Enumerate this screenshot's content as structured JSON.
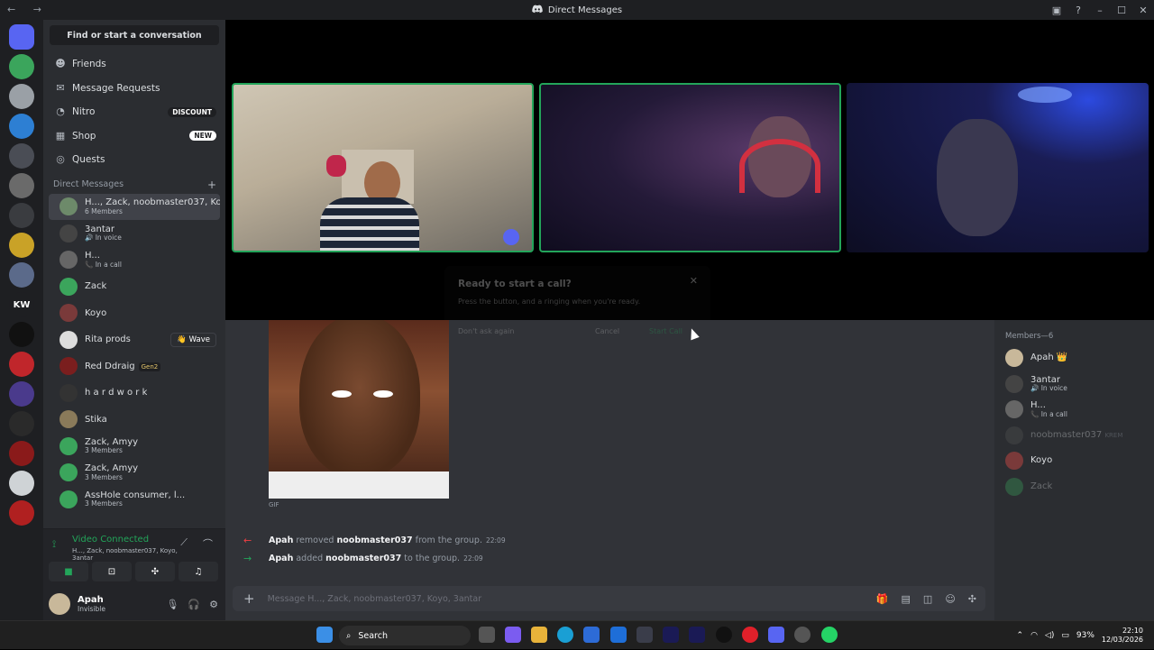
{
  "window": {
    "title": "Direct Messages"
  },
  "guilds": [
    {
      "label": "",
      "color": "#5865f2"
    },
    {
      "label": "",
      "color": "#3ba55c"
    },
    {
      "label": "",
      "color": "#9aa0a6"
    },
    {
      "label": "",
      "color": "#2d7fd3"
    },
    {
      "label": "",
      "color": "#4a4d55"
    },
    {
      "label": "",
      "color": "#6a6a6a"
    },
    {
      "label": "",
      "color": "#3a3c40"
    },
    {
      "label": "",
      "color": "#c9a227"
    },
    {
      "label": "",
      "color": "#5b6a8a"
    },
    {
      "label": "KW",
      "color": "#1e1f22"
    },
    {
      "label": "",
      "color": "#111111"
    },
    {
      "label": "",
      "color": "#c0262b"
    },
    {
      "label": "",
      "color": "#4a3a8c"
    },
    {
      "label": "",
      "color": "#2a2a2a"
    },
    {
      "label": "",
      "color": "#8a1a1a"
    },
    {
      "label": "",
      "color": "#cfd3d6"
    },
    {
      "label": "",
      "color": "#b02020"
    }
  ],
  "sidebar": {
    "search_label": "Find or start a conversation",
    "nav": [
      {
        "label": "Friends",
        "icon": "friends-icon"
      },
      {
        "label": "Message Requests",
        "icon": "mail-icon"
      },
      {
        "label": "Nitro",
        "icon": "nitro-icon",
        "badge": "DISCOUNT"
      },
      {
        "label": "Shop",
        "icon": "shop-icon",
        "badge": "NEW"
      },
      {
        "label": "Quests",
        "icon": "quests-icon"
      }
    ],
    "dm_header": "Direct Messages",
    "dms": [
      {
        "name": "H..., Zack, noobmaster037, Koy...",
        "sub": "6 Members",
        "color": "#6d8a6a",
        "selected": true
      },
      {
        "name": "3antar",
        "sub": "🔊 In voice",
        "color": "#444"
      },
      {
        "name": "H...",
        "sub": "📞 In a call",
        "color": "#666"
      },
      {
        "name": "Zack",
        "sub": "",
        "color": "#3ba55c"
      },
      {
        "name": "Koyo",
        "sub": "",
        "color": "#7a3a3a"
      },
      {
        "name": "Rita prods",
        "sub": "",
        "color": "#dddddd",
        "wave": "👋 Wave"
      },
      {
        "name": "Red Ddraig",
        "sub": "",
        "color": "#7a1e1e",
        "tag": "Gen2"
      },
      {
        "name": "h a r d w o r k",
        "sub": "",
        "color": "#333"
      },
      {
        "name": "Stika",
        "sub": "",
        "color": "#8a7a5a"
      },
      {
        "name": "Zack, Amyy",
        "sub": "3 Members",
        "color": "#3ba55c"
      },
      {
        "name": "Zack, Amyy",
        "sub": "3 Members",
        "color": "#3ba55c"
      },
      {
        "name": "AssHole consumer, l...",
        "sub": "3 Members",
        "color": "#3ba55c"
      }
    ]
  },
  "voice": {
    "status": "Video Connected",
    "channel": "H..., Zack, noobmaster037, Koyo, 3antar"
  },
  "user": {
    "name": "Apah",
    "status": "Invisible"
  },
  "call_modal": {
    "title": "Ready to start a call?",
    "subtitle": "Press the button, and a ringing when you're ready.",
    "checkbox": "Don't ask again",
    "cancel": "Cancel",
    "start": "Start Call"
  },
  "chat": {
    "gif_label": "GIF",
    "messages": [
      {
        "actor": "Apah",
        "action": "removed",
        "target": "noobmaster037",
        "tail": "from the group.",
        "time": "22:09",
        "arrow": "←",
        "arrow_color": "#f23f43"
      },
      {
        "actor": "Apah",
        "action": "added",
        "target": "noobmaster037",
        "tail": "to the group.",
        "time": "22:09",
        "arrow": "→",
        "arrow_color": "#23a55a"
      }
    ],
    "placeholder": "Message H..., Zack, noobmaster037, Koyo, 3antar"
  },
  "members": {
    "header": "Members—6",
    "list": [
      {
        "name": "Apah 👑",
        "sub": "",
        "color": "#c8b89a"
      },
      {
        "name": "3antar",
        "sub": "🔊 In voice",
        "color": "#444"
      },
      {
        "name": "H...",
        "sub": "📞 In a call",
        "color": "#666"
      },
      {
        "name": "noobmaster037",
        "sub": "",
        "tag": "KREM",
        "color": "#555",
        "dim": true
      },
      {
        "name": "Koyo",
        "sub": "",
        "color": "#7a3a3a"
      },
      {
        "name": "Zack",
        "sub": "",
        "color": "#3ba55c",
        "dim": true
      }
    ]
  },
  "taskbar": {
    "search": "Search",
    "battery": "93%",
    "time": "22:10",
    "date": "12/03/2026"
  },
  "colors": {
    "accent": "#5865f2",
    "online": "#23a55a",
    "danger": "#f23f43"
  }
}
